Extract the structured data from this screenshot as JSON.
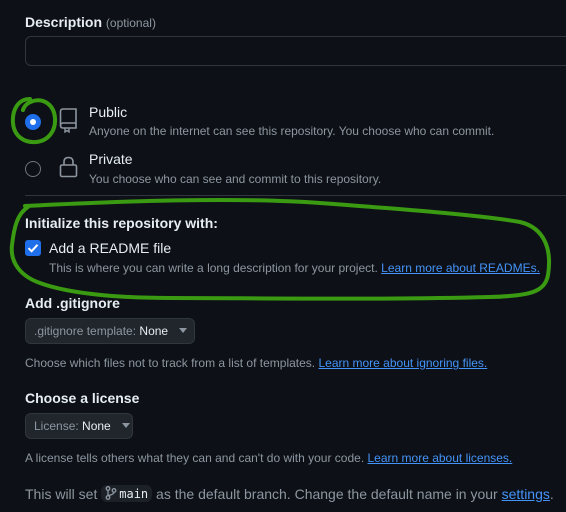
{
  "description": {
    "label": "Description",
    "optional": "(optional)",
    "value": "",
    "placeholder": ""
  },
  "visibility": {
    "public": {
      "title": "Public",
      "desc": "Anyone on the internet can see this repository. You choose who can commit.",
      "selected": true
    },
    "private": {
      "title": "Private",
      "desc": "You choose who can see and commit to this repository.",
      "selected": false
    }
  },
  "init": {
    "heading": "Initialize this repository with:",
    "readme_label": "Add a README file",
    "readme_checked": true,
    "readme_desc": "This is where you can write a long description for your project.",
    "readme_link": "Learn more about READMEs."
  },
  "gitignore": {
    "heading": "Add .gitignore",
    "dropdown_prefix": ".gitignore template:",
    "dropdown_value": "None",
    "help": "Choose which files not to track from a list of templates.",
    "help_link": "Learn more about ignoring files."
  },
  "license": {
    "heading": "Choose a license",
    "dropdown_prefix": "License:",
    "dropdown_value": "None",
    "help": "A license tells others what they can and can't do with your code.",
    "help_link": "Learn more about licenses."
  },
  "branch": {
    "prefix": "This will set",
    "name": "main",
    "middle": "as the default branch. Change the default name in your",
    "link": "settings",
    "suffix": "."
  },
  "colors": {
    "accent": "#1f6feb",
    "link": "#4493f8",
    "annotation": "#3a9a12"
  },
  "icons": {
    "public": "repo-icon",
    "private": "lock-icon",
    "branch": "git-branch-icon",
    "checkbox": "check-icon"
  }
}
